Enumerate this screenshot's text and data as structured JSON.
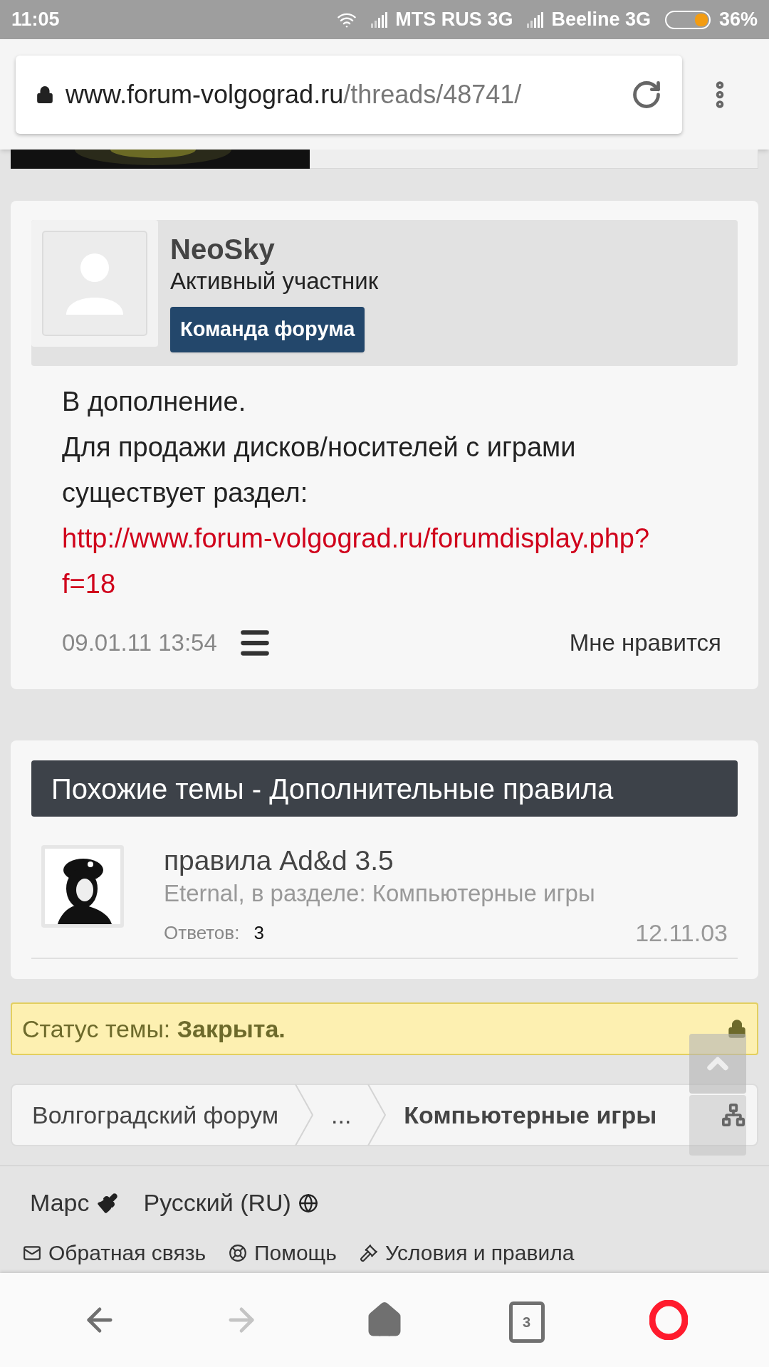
{
  "status_bar": {
    "time": "11:05",
    "carriers": [
      {
        "name": "MTS RUS 3G"
      },
      {
        "name": "Beeline 3G"
      }
    ],
    "battery": "36%"
  },
  "address_bar": {
    "host": "www.forum-volgograd.ru",
    "path": "/threads/48741/"
  },
  "post": {
    "author": "NeoSky",
    "role": "Активный участник",
    "badge": "Команда форума",
    "lines": [
      "В дополнение.",
      "Для продажи дисков/носителей с играми существует раздел:"
    ],
    "link": "http://www.forum-volgograd.ru/forumdisplay.php?f=18",
    "date": "09.01.11 13:54",
    "like": "Мне нравится"
  },
  "similar": {
    "title": "Похожие темы - Дополнительные правила",
    "items": [
      {
        "title": "правила Ad&d 3.5",
        "meta": "Eternal, в разделе: Компьютерные игры",
        "replies_label": "Ответов:",
        "replies": "3",
        "date": "12.11.03"
      }
    ]
  },
  "thread_status": "Статус темы: **Закрыта.**",
  "breadcrumb": [
    {
      "label": "Волгоградский форум",
      "current": false
    },
    {
      "label": "...",
      "current": false
    },
    {
      "label": "Компьютерные игры",
      "current": true
    }
  ],
  "footer": {
    "style": "Марс",
    "language": "Русский (RU)",
    "links": [
      {
        "kind": "mail",
        "label": "Обратная связь"
      },
      {
        "kind": "help",
        "label": "Помощь"
      },
      {
        "kind": "rules",
        "label": "Условия и правила"
      }
    ]
  },
  "nav": {
    "back_disabled": false,
    "forward_disabled": true,
    "tab_count": "3"
  }
}
